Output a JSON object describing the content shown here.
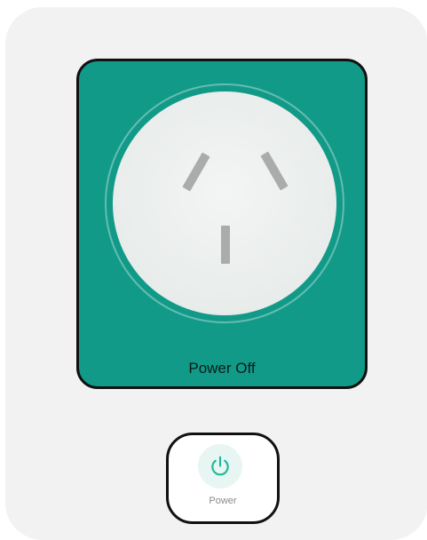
{
  "socket": {
    "status_text": "Power Off",
    "panel_color": "#129a88",
    "face_color": "#eef1f0",
    "pin_color": "#a9acab"
  },
  "power_button": {
    "label": "Power",
    "icon": "power-icon",
    "icon_color": "#1fb89f"
  }
}
